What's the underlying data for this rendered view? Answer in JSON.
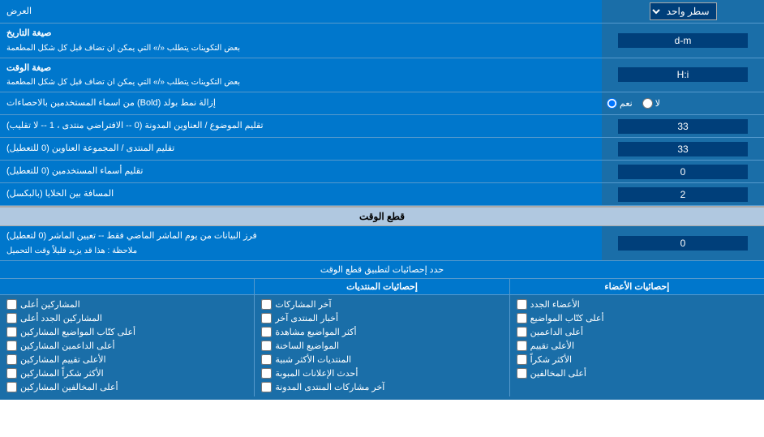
{
  "rows": [
    {
      "id": "row_erz",
      "label": "العرض",
      "inputType": "dropdown",
      "value": "سطر واحد"
    },
    {
      "id": "row_date_format",
      "label": "صيغة التاريخ\nبعض التكوينات يتطلب «/» التي يمكن ان تضاف قبل كل شكل المطعمة",
      "inputType": "text",
      "value": "d-m"
    },
    {
      "id": "row_time_format",
      "label": "صيغة الوقت\nبعض التكوينات يتطلب «/» التي يمكن ان تضاف قبل كل شكل المطعمة",
      "inputType": "text",
      "value": "H:i"
    },
    {
      "id": "row_bold",
      "label": "إزالة نمط بولد (Bold) من اسماء المستخدمين بالاحصاءات",
      "inputType": "radio",
      "options": [
        "نعم",
        "لا"
      ],
      "selected": "نعم"
    },
    {
      "id": "row_subject_address",
      "label": "تقليم الموضوع / العناوين المدونة (0 -- الافتراضي منتدى ، 1 -- لا تقليب)",
      "inputType": "text",
      "value": "33"
    },
    {
      "id": "row_forum_address",
      "label": "تقليم المنتدى / المجموعة العناوين (0 للتعطيل)",
      "inputType": "text",
      "value": "33"
    },
    {
      "id": "row_username_trunc",
      "label": "تقليم أسماء المستخدمين (0 للتعطيل)",
      "inputType": "text",
      "value": "0"
    },
    {
      "id": "row_distance",
      "label": "المسافة بين الخلايا (بالبكسل)",
      "inputType": "text",
      "value": "2"
    }
  ],
  "section_cutoff": {
    "title": "قطع الوقت",
    "row": {
      "label": "فرز البيانات من يوم الماشر الماضي فقط -- تعيين الماشر (0 لتعطيل)\nملاحظة : هذا قد يزيد قليلاً وقت التحميل",
      "value": "0"
    },
    "filter_label": "حدد إحصائيات لتطبيق قطع الوقت"
  },
  "stats_columns": [
    {
      "header": "إحصائيات الأعضاء",
      "items": [
        "الأعضاء الجدد",
        "أعلى كتّاب المواضيع",
        "أعلى الداعمين",
        "الأعلى تقييم",
        "الأكثر شكراً",
        "أعلى المخالفين"
      ]
    },
    {
      "header": "إحصائيات المنتديات",
      "items": [
        "آخر المشاركات",
        "أخبار المنتدى آخر",
        "أكثر المواضيع مشاهدة",
        "المواضيع الساخنة",
        "المنتديات الأكثر شبية",
        "أحدث الإعلانات المبوبة",
        "آخر مشاركات المنتدى المدونة"
      ]
    },
    {
      "header": "",
      "items": [
        "المشاركين أعلى",
        "المشاركين الجدد أعلى",
        "أعلى كتّاب المواضيع المشاركين",
        "أعلى الداعمين المشاركين",
        "الأعلى تقييم المشاركين",
        "الأكثر شكراً المشاركين",
        "أعلى المخالفين المشاركين"
      ]
    }
  ],
  "ui": {
    "erz_label": "العرض",
    "erz_value": "سطر واحد",
    "date_format_label": "صيغة التاريخ",
    "date_format_note": "بعض التكوينات يتطلب «/» التي يمكن ان تضاف قبل كل شكل المطعمة",
    "time_format_label": "صيغة الوقت",
    "time_format_note": "بعض التكوينات يتطلب «/» التي يمكن ان تضاف قبل كل شكل المطعمة",
    "bold_label": "إزالة نمط بولد (Bold) من اسماء المستخدمين بالاحصاءات",
    "yes": "نعم",
    "no": "لا",
    "subject_label": "تقليم الموضوع / العناوين المدونة (0 -- الافتراضي منتدى ، 1 -- لا تقليب)",
    "forum_label": "تقليم المنتدى / المجموعة العناوين (0 للتعطيل)",
    "username_label": "تقليم أسماء المستخدمين (0 للتعطيل)",
    "distance_label": "المسافة بين الخلايا (بالبكسل)",
    "section_cutoff_title": "قطع الوقت",
    "cutoff_label": "فرز البيانات من يوم الماشر الماضي فقط -- تعيين الماشر (0 لتعطيل)",
    "cutoff_note": "ملاحظة : هذا قد يزيد قليلاً وقت التحميل",
    "filter_label": "حدد إحصائيات لتطبيق قطع الوقت",
    "header_members": "إحصائيات الأعضاء",
    "header_forums": "إحصائيات المنتديات",
    "members_items": [
      "الأعضاء الجدد",
      "أعلى كتّاب المواضيع",
      "أعلى الداعمين",
      "الأعلى تقييم",
      "الأكثر شكراً",
      "أعلى المخالفين"
    ],
    "forum_items": [
      "آخر المشاركات",
      "أخبار المنتدى آخر",
      "أكثر المواضيع مشاهدة",
      "المواضيع الساخنة",
      "المنتديات الأكثر شبية",
      "أحدث الإعلانات المبوبة",
      "آخر مشاركات المنتدى المدونة"
    ],
    "third_col_items": [
      "المشاركين أعلى",
      "المشاركين الجدد أعلى",
      "أعلى كتّاب المواضيع المشاركين",
      "أعلى الداعمين المشاركين",
      "الأعلى تقييم المشاركين",
      "الأكثر شكراً المشاركين",
      "أعلى المخالفين المشاركين"
    ]
  }
}
